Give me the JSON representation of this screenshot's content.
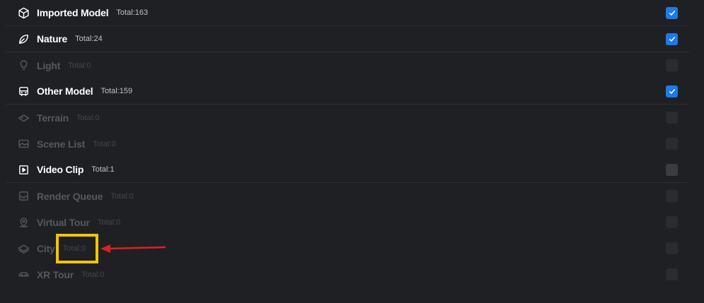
{
  "categories": [
    {
      "label": "Imported Model",
      "total": "Total:163",
      "icon": "cube-icon",
      "enabled": true,
      "checked": true
    },
    {
      "label": "Nature",
      "total": "Total:24",
      "icon": "leaf-icon",
      "enabled": true,
      "checked": true
    },
    {
      "label": "Light",
      "total": "Total:0",
      "icon": "lightbulb-icon",
      "enabled": false,
      "checked": false
    },
    {
      "label": "Other Model",
      "total": "Total:159",
      "icon": "bus-icon",
      "enabled": true,
      "checked": true
    },
    {
      "label": "Terrain",
      "total": "Total:0",
      "icon": "terrain-icon",
      "enabled": false,
      "checked": false
    },
    {
      "label": "Scene List",
      "total": "Total:0",
      "icon": "image-icon",
      "enabled": false,
      "checked": false
    },
    {
      "label": "Video Clip",
      "total": "Total:1",
      "icon": "play-icon",
      "enabled": true,
      "checked": false
    },
    {
      "label": "Render Queue",
      "total": "Total:0",
      "icon": "tray-icon",
      "enabled": false,
      "checked": false
    },
    {
      "label": "Virtual Tour",
      "total": "Total:0",
      "icon": "map-pin-icon",
      "enabled": false,
      "checked": false
    },
    {
      "label": "City",
      "total": "Total:0",
      "icon": "city-layers-icon",
      "enabled": false,
      "checked": false
    },
    {
      "label": "XR Tour",
      "total": "Total:0",
      "icon": "vr-headset-icon",
      "enabled": false,
      "checked": false
    }
  ],
  "colors": {
    "background": "#1f2024",
    "checkbox_on": "#1d7ae8",
    "highlight": "#f5c400",
    "arrow": "#e02020"
  }
}
